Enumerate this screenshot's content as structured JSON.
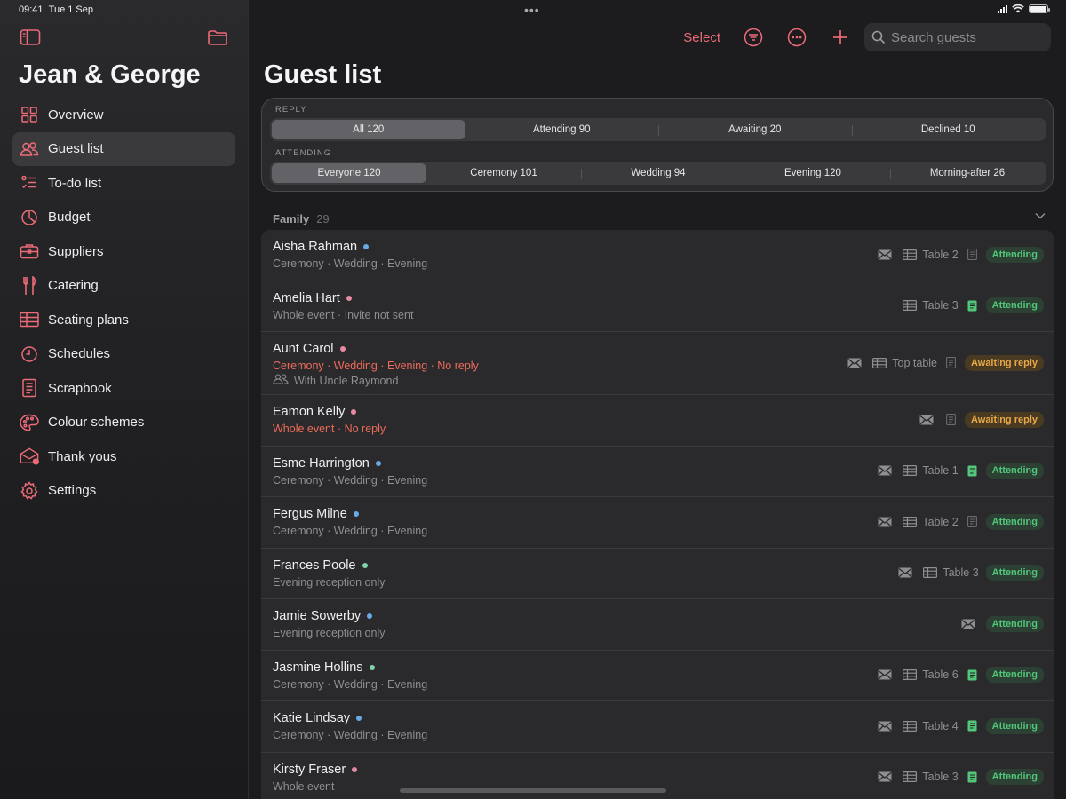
{
  "status": {
    "time": "09:41",
    "date": "Tue 1 Sep"
  },
  "sidebar": {
    "title": "Jean & George",
    "items": [
      {
        "label": "Overview",
        "icon": "grid-icon"
      },
      {
        "label": "Guest list",
        "icon": "people-icon",
        "active": true
      },
      {
        "label": "To-do list",
        "icon": "checklist-icon"
      },
      {
        "label": "Budget",
        "icon": "pie-chart-icon"
      },
      {
        "label": "Suppliers",
        "icon": "briefcase-icon"
      },
      {
        "label": "Catering",
        "icon": "fork-knife-icon"
      },
      {
        "label": "Seating plans",
        "icon": "table-icon"
      },
      {
        "label": "Schedules",
        "icon": "clock-icon"
      },
      {
        "label": "Scrapbook",
        "icon": "notebook-icon"
      },
      {
        "label": "Colour schemes",
        "icon": "palette-icon"
      },
      {
        "label": "Thank yous",
        "icon": "envelope-badge-icon"
      },
      {
        "label": "Settings",
        "icon": "gear-icon"
      }
    ]
  },
  "toolbar": {
    "select_label": "Select",
    "search_placeholder": "Search guests"
  },
  "page": {
    "title": "Guest list"
  },
  "filters": {
    "reply": {
      "label": "REPLY",
      "options": [
        "All 120",
        "Attending 90",
        "Awaiting 20",
        "Declined 10"
      ],
      "selected": 0
    },
    "attending": {
      "label": "ATTENDING",
      "options": [
        "Everyone 120",
        "Ceremony 101",
        "Wedding 94",
        "Evening 120",
        "Morning-after 26"
      ],
      "selected": 0
    }
  },
  "group": {
    "name": "Family",
    "count": "29"
  },
  "colors": {
    "accent": "#ec6b78",
    "attending": "#52c77a",
    "awaiting": "#e8a849",
    "dot_blue": "#6aa9e6",
    "dot_pink": "#e88aa3",
    "dot_green": "#7fd3a6"
  },
  "guests": [
    {
      "name": "Aisha Rahman",
      "dot": "blue",
      "events": "Ceremony · Wedding · Evening",
      "warn": false,
      "table": "Table 2",
      "note": "outline",
      "status": "Attending"
    },
    {
      "name": "Amelia Hart",
      "dot": "pink",
      "events": "Whole event · Invite not sent",
      "warn": false,
      "table": "Table 3",
      "note": "green",
      "status": "Attending",
      "no_mail": true
    },
    {
      "name": "Aunt Carol",
      "dot": "pink",
      "events": "Ceremony · Wedding · Evening · No reply",
      "warn": true,
      "with": "With Uncle Raymond",
      "table": "Top table",
      "note": "outline",
      "status": "Awaiting reply"
    },
    {
      "name": "Eamon Kelly",
      "dot": "pink",
      "events": "Whole event · No reply",
      "warn": true,
      "table": "",
      "note": "outline",
      "status": "Awaiting reply"
    },
    {
      "name": "Esme Harrington",
      "dot": "blue",
      "events": "Ceremony · Wedding · Evening",
      "warn": false,
      "table": "Table 1",
      "note": "green",
      "status": "Attending"
    },
    {
      "name": "Fergus Milne",
      "dot": "blue",
      "events": "Ceremony · Wedding · Evening",
      "warn": false,
      "table": "Table 2",
      "note": "outline",
      "status": "Attending"
    },
    {
      "name": "Frances Poole",
      "dot": "green",
      "events": "Evening reception only",
      "warn": false,
      "table": "Table 3",
      "note": "",
      "status": "Attending"
    },
    {
      "name": "Jamie Sowerby",
      "dot": "blue",
      "events": "Evening reception only",
      "warn": false,
      "table": "",
      "note": "",
      "status": "Attending"
    },
    {
      "name": "Jasmine Hollins",
      "dot": "green",
      "events": "Ceremony · Wedding · Evening",
      "warn": false,
      "table": "Table 6",
      "note": "green",
      "status": "Attending"
    },
    {
      "name": "Katie Lindsay",
      "dot": "blue",
      "events": "Ceremony · Wedding · Evening",
      "warn": false,
      "table": "Table 4",
      "note": "green",
      "status": "Attending"
    },
    {
      "name": "Kirsty Fraser",
      "dot": "pink",
      "events": "Whole event",
      "warn": false,
      "table": "Table 3",
      "note": "green",
      "status": "Attending"
    }
  ]
}
